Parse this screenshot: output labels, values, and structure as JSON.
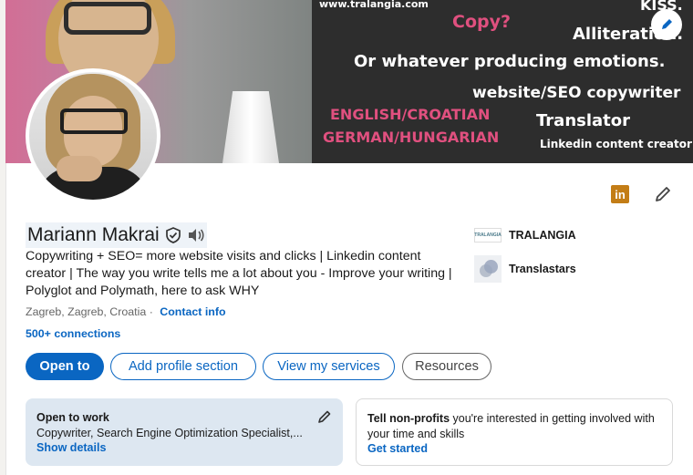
{
  "banner": {
    "url": "www.tralangia.com",
    "kiss": "KISS.",
    "copy": "Copy?",
    "alliteration": "Alliteration.",
    "emotions": "Or  whatever producing emotions.",
    "seo": "website/SEO copywriter",
    "lang1": "ENGLISH/CROATIAN",
    "lang2": "GERMAN/HUNGARIAN",
    "translator": "Translator",
    "linkedin_creator": "Linkedin content creator",
    "colors": {
      "pink_text": "#e0507f",
      "white_text": "#ffffff",
      "dark_bg": "#2d2d2d"
    }
  },
  "profile": {
    "name": "Mariann Makrai",
    "headline": "Copywriting + SEO= more website visits and clicks | Linkedin content creator | The way you write tells me a lot about you - Improve your writing | Polyglot and Polymath, here to ask WHY",
    "location": "Zagreb, Zagreb, Croatia",
    "location_separator": "·",
    "contact_info": "Contact info",
    "connections": "500+ connections"
  },
  "side": {
    "company1": {
      "name": "TRALANGIA",
      "logo_text": "TRALANGIA"
    },
    "company2": {
      "name": "Translastars"
    }
  },
  "actions": {
    "open_to": "Open to",
    "add_profile_section": "Add profile section",
    "view_services": "View my services",
    "resources": "Resources"
  },
  "open_to_work": {
    "title": "Open to work",
    "roles": "Copywriter, Search Engine Optimization Specialist,...",
    "link": "Show details"
  },
  "nonprofits": {
    "bold": "Tell non-profits",
    "text": " you're interested in getting involved with your time and skills",
    "link": "Get started"
  },
  "icons": {
    "linkedin_badge": "in",
    "accent": "#0a66c2",
    "badge_color": "#c37d16"
  }
}
